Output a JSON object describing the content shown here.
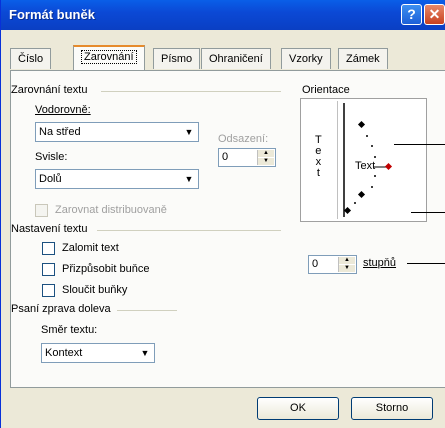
{
  "window": {
    "title": "Formát buněk",
    "help_label": "?",
    "close_label": "✕"
  },
  "tabs": [
    "Číslo",
    "Zarovnání",
    "Písmo",
    "Ohraničení",
    "Vzorky",
    "Zámek"
  ],
  "text_alignment": {
    "group_title": "Zarovnání textu",
    "horizontal_label": "Vodorovně:",
    "horizontal_value": "Na střed",
    "indent_label": "Odsazení:",
    "indent_value": "0",
    "vertical_label": "Svisle:",
    "vertical_value": "Dolů",
    "distributed_label": "Zarovnat distribuovaně"
  },
  "text_control": {
    "group_title": "Nastavení textu",
    "wrap_label": "Zalomit text",
    "shrink_label": "Přizpůsobit buňce",
    "merge_label": "Sloučit buňky"
  },
  "rtl": {
    "group_title": "Psaní zprava doleva",
    "direction_label": "Směr textu:",
    "direction_value": "Kontext"
  },
  "orientation": {
    "group_title": "Orientace",
    "vertical_text": [
      "T",
      "e",
      "x",
      "t"
    ],
    "text_label": "Text",
    "degrees_value": "0",
    "degrees_label": "stupňů",
    "indicator_color": "#c00000"
  },
  "buttons": {
    "ok": "OK",
    "cancel": "Storno"
  }
}
